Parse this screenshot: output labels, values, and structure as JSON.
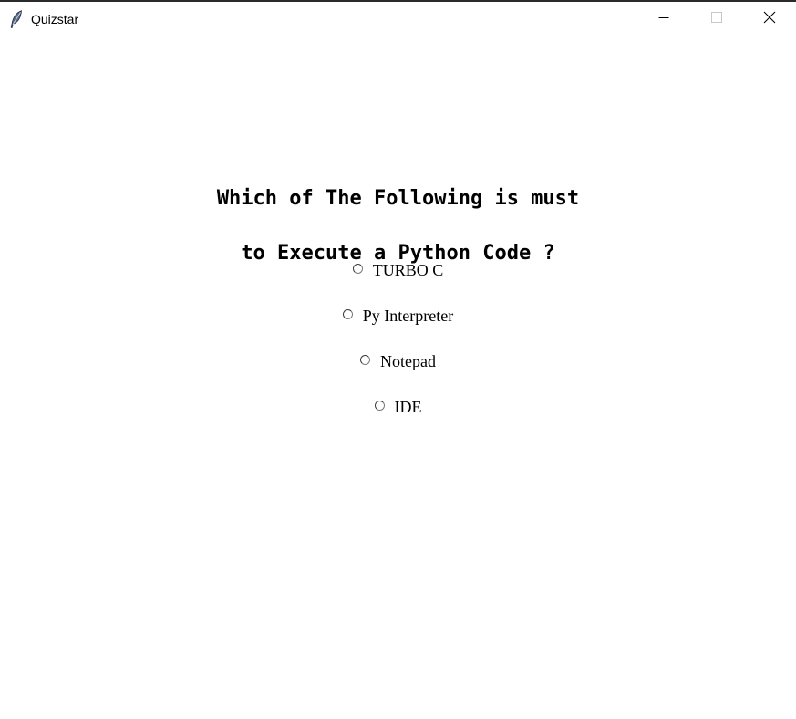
{
  "window": {
    "title": "Quizstar",
    "icon": "feather-icon",
    "controls": [
      "minimize-icon",
      "maximize-icon",
      "close-icon"
    ]
  },
  "quiz": {
    "question_line1": "Which of The Following is must",
    "question_line2": "to Execute a Python Code ?",
    "options": [
      {
        "label": "TURBO C",
        "selected": false
      },
      {
        "label": "Py Interpreter",
        "selected": false
      },
      {
        "label": "Notepad",
        "selected": false
      },
      {
        "label": "IDE",
        "selected": false
      }
    ]
  }
}
